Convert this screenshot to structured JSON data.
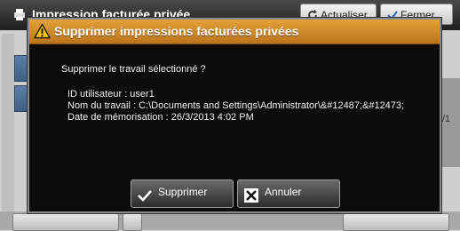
{
  "background": {
    "window_title": "Impression facturée privée",
    "refresh_label": "Actualiser",
    "close_label": "Fermer",
    "page_indicator": "/1"
  },
  "dialog": {
    "title": "Supprimer impressions facturées privées",
    "question": "Supprimer le travail sélectionné ?",
    "details": {
      "user_id": "ID utilisateur : user1",
      "job_name": "Nom du travail : C:\\Documents and Settings\\Administrator\\&#12487;&#12473;",
      "stored_date": "Date de mémorisation : 26/3/2013 4:02 PM"
    },
    "buttons": {
      "delete_label": "Supprimer",
      "cancel_label": "Annuler"
    }
  },
  "colors": {
    "title_bar": "#d08a2a",
    "dialog_bg": "#000000",
    "text": "#f0f0f0"
  },
  "icons": {
    "title_icon": "warning-icon",
    "delete_icon": "check-icon",
    "cancel_icon": "x-icon"
  }
}
